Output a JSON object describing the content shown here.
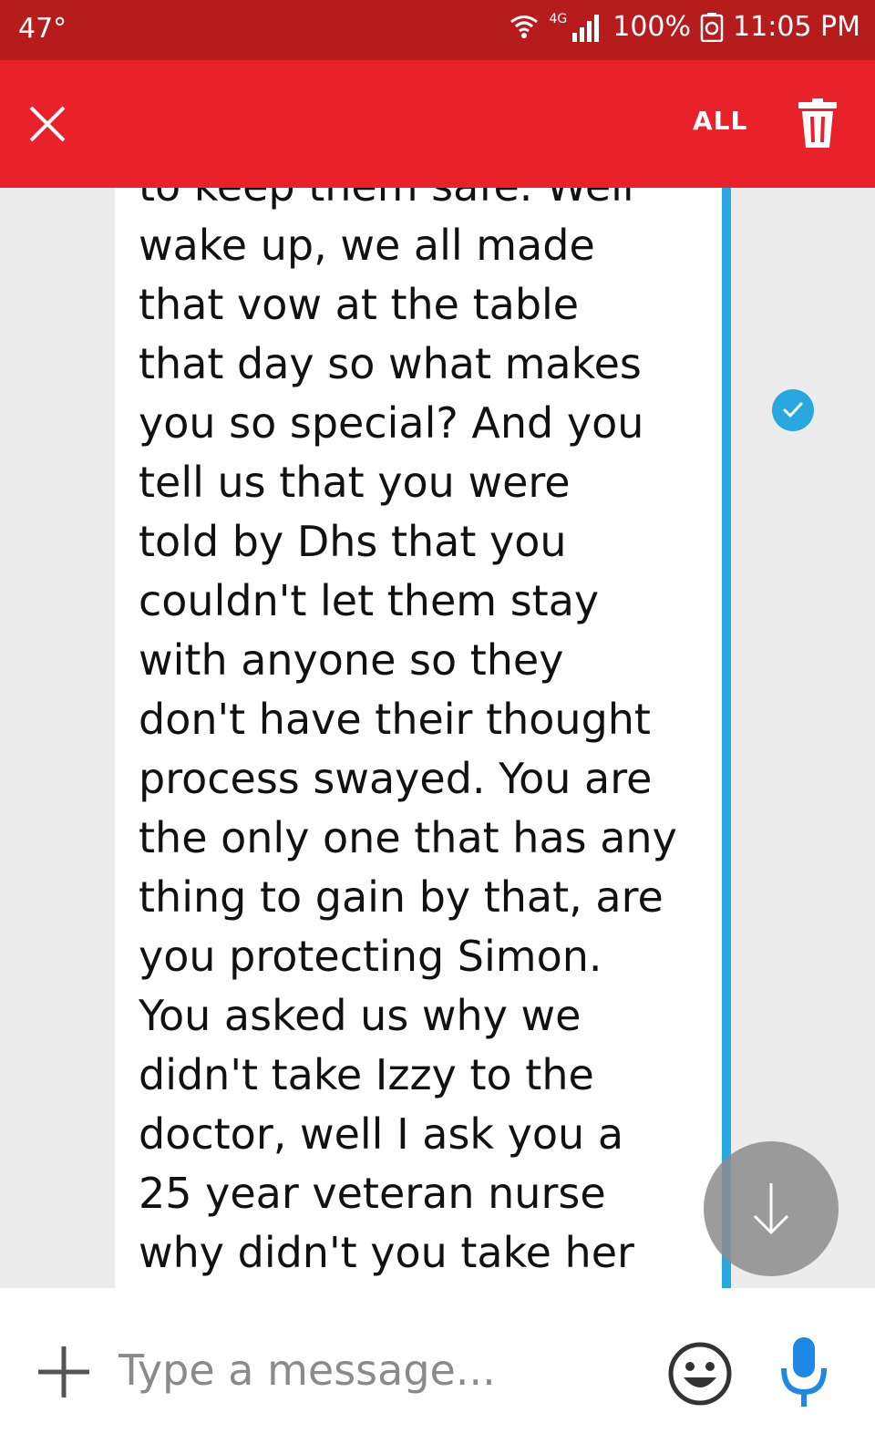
{
  "status_bar": {
    "temperature": "47°",
    "network": "4G",
    "battery": "100%",
    "time": "11:05 PM",
    "icons": [
      "wifi-icon",
      "signal-icon",
      "sync-icon"
    ]
  },
  "action_bar": {
    "select_all_label": "ALL",
    "icons": [
      "close-icon",
      "trash-icon"
    ]
  },
  "conversation": {
    "message_lines": [
      "to keep them safe. Well",
      "wake up, we all made",
      "that vow at the table",
      "that day so what makes",
      "you so special? And you",
      "tell us that you were",
      "told by Dhs that you",
      "couldn't let them stay",
      "with anyone so they",
      "don't have their thought",
      "process swayed. You are",
      "the only one that has any",
      "thing to gain by that, are",
      "you protecting Simon.",
      "You asked us why we",
      "didn't take Izzy to the",
      "doctor, well I ask you a",
      "25 year veteran nurse",
      "why didn't you take her"
    ],
    "selected": true
  },
  "composer": {
    "placeholder": "Type a message...",
    "icons": [
      "add-icon",
      "emoji-icon",
      "mic-icon"
    ]
  },
  "colors": {
    "status_bar": "#b71c1c",
    "action_bar": "#e8212a",
    "selection_accent": "#29a8e0",
    "background": "#ececec"
  }
}
